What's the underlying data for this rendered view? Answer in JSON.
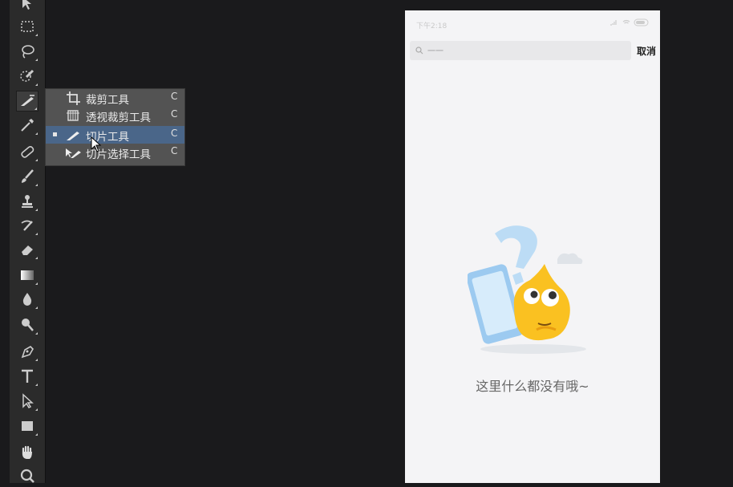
{
  "toolbar": {
    "tools": [
      {
        "name": "move-tool-icon"
      },
      {
        "name": "marquee-tool-icon"
      },
      {
        "name": "lasso-tool-icon"
      },
      {
        "name": "quick-selection-tool-icon"
      },
      {
        "name": "slice-tool-icon",
        "active": true
      },
      {
        "name": "eyedropper-tool-icon"
      },
      {
        "name": "healing-brush-tool-icon"
      },
      {
        "name": "brush-tool-icon"
      },
      {
        "name": "clone-stamp-tool-icon"
      },
      {
        "name": "history-brush-tool-icon"
      },
      {
        "name": "eraser-tool-icon"
      },
      {
        "name": "gradient-tool-icon"
      },
      {
        "name": "blur-tool-icon"
      },
      {
        "name": "dodge-tool-icon"
      },
      {
        "name": "pen-tool-icon"
      },
      {
        "name": "type-tool-icon"
      },
      {
        "name": "path-selection-tool-icon"
      },
      {
        "name": "rectangle-tool-icon"
      },
      {
        "name": "hand-tool-icon"
      },
      {
        "name": "zoom-tool-icon"
      }
    ]
  },
  "flyout": {
    "items": [
      {
        "label": "裁剪工具",
        "key": "C",
        "icon": "crop-icon"
      },
      {
        "label": "透视裁剪工具",
        "key": "C",
        "icon": "perspective-crop-icon"
      },
      {
        "label": "切片工具",
        "key": "C",
        "icon": "slice-icon",
        "selected": true
      },
      {
        "label": "切片选择工具",
        "key": "C",
        "icon": "slice-select-icon"
      }
    ]
  },
  "phone": {
    "status_time": "下午2:18",
    "search_placeholder": "一一",
    "cancel_label": "取消",
    "empty_message": "这里什么都没有哦~"
  },
  "colors": {
    "toolbar_bg": "#2b2b2b",
    "flyout_bg": "#535353",
    "flyout_selected": "#4a6689",
    "canvas_bg": "#1a1a1c",
    "phone_bg": "#f4f4f6"
  }
}
